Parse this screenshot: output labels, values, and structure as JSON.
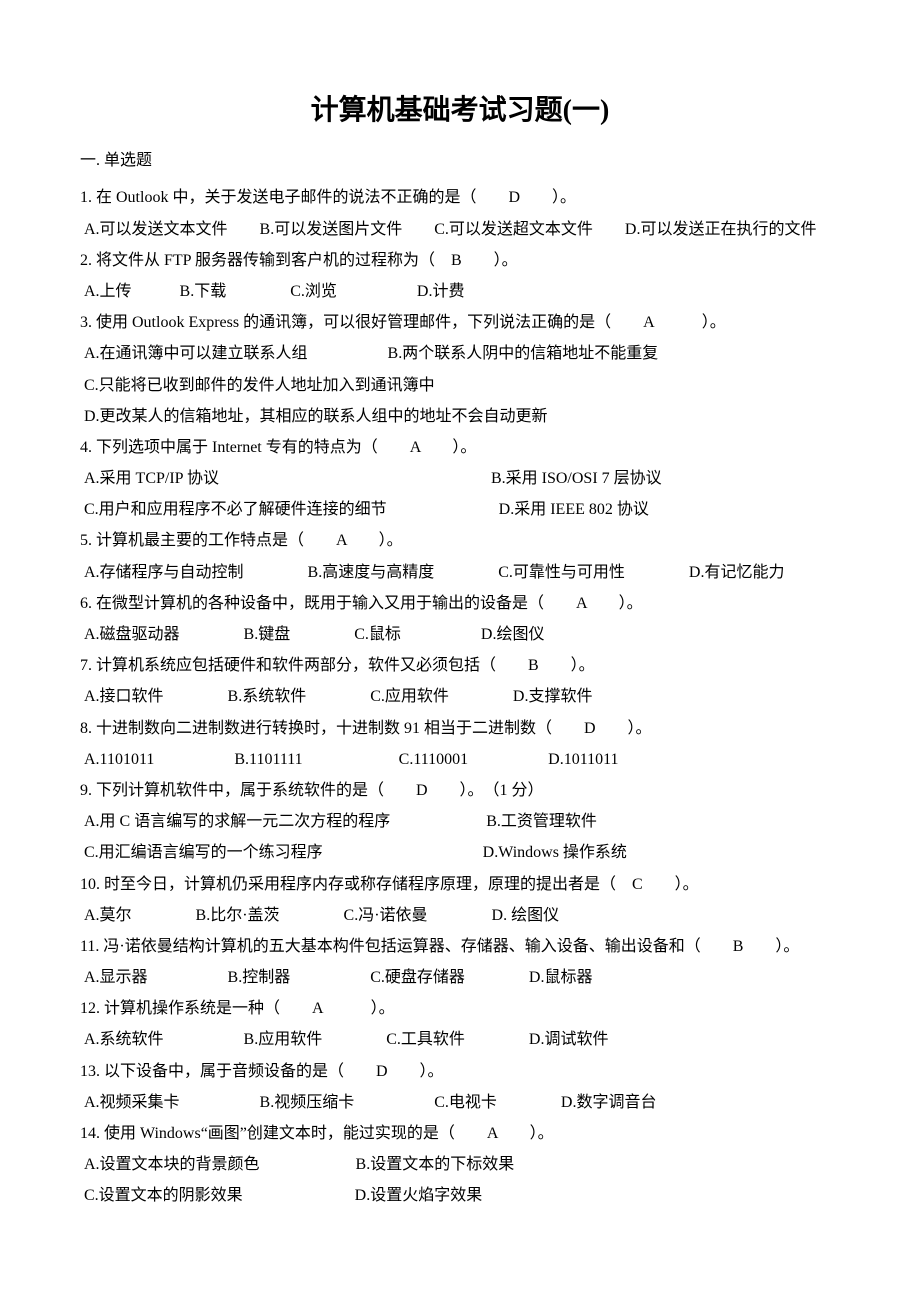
{
  "title": "计算机基础考试习题(一)",
  "section": "一. 单选题",
  "questions": [
    {
      "stem": "1. 在 Outlook 中，关于发送电子邮件的说法不正确的是（　　D　　）。",
      "opts": [
        "A.可以发送文本文件　　B.可以发送图片文件　　C.可以发送超文本文件　　D.可以发送正在执行的文件"
      ]
    },
    {
      "stem": "2. 将文件从 FTP 服务器传输到客户机的过程称为（　B　　）。",
      "opts": [
        "A.上传　　　B.下载　　　　C.浏览　　　　　D.计费"
      ]
    },
    {
      "stem": "3. 使用 Outlook Express 的通讯簿，可以很好管理邮件，下列说法正确的是（　　A　　　）。",
      "opts": [
        "A.在通讯簿中可以建立联系人组　　　　　B.两个联系人阴中的信箱地址不能重复",
        "C.只能将已收到邮件的发件人地址加入到通讯簿中",
        "D.更改某人的信箱地址，其相应的联系人组中的地址不会自动更新"
      ]
    },
    {
      "stem": "4. 下列选项中属于 Internet 专有的特点为（　　A　　）。",
      "opts": [
        "A.采用 TCP/IP 协议　　　　　　　　　　　　　　　　　B.采用 ISO/OSI 7 层协议",
        "C.用户和应用程序不必了解硬件连接的细节　　　　　　　D.采用 IEEE 802 协议"
      ]
    },
    {
      "stem": "5. 计算机最主要的工作特点是（　　A　　）。",
      "opts": [
        "A.存储程序与自动控制　　　　B.高速度与高精度　　　　C.可靠性与可用性　　　　D.有记忆能力"
      ]
    },
    {
      "stem": "6. 在微型计算机的各种设备中，既用于输入又用于输出的设备是（　　A　　）。",
      "opts": [
        "A.磁盘驱动器　　　　B.键盘　　　　C.鼠标　　　　　D.绘图仪"
      ]
    },
    {
      "stem": "7. 计算机系统应包括硬件和软件两部分，软件又必须包括（　　B　　）。",
      "opts": [
        "A.接口软件　　　　B.系统软件　　　　C.应用软件　　　　D.支撑软件"
      ]
    },
    {
      "stem": "8. 十进制数向二进制数进行转换时，十进制数 91 相当于二进制数（　　D　　）。",
      "opts": [
        "A.1101011　　　　　B.1101111　　　　　　C.1110001　　　　　D.1011011"
      ]
    },
    {
      "stem": "9. 下列计算机软件中，属于系统软件的是（　　D　　）。　（1 分）",
      "opts": [
        "A.用 C 语言编写的求解一元二次方程的程序　　　　　　B.工资管理软件",
        "C.用汇编语言编写的一个练习程序　　　　　　　　　　D.Windows 操作系统"
      ]
    },
    {
      "stem": "10. 时至今日，计算机仍采用程序内存或称存储程序原理，原理的提出者是（　C　　）。",
      "opts": [
        "A.莫尔　　　　B.比尔·盖茨　　　　C.冯·诺依曼　　　　D. 绘图仪"
      ]
    },
    {
      "stem": "11. 冯·诺依曼结构计算机的五大基本构件包括运算器、存储器、输入设备、输出设备和（　　B　　）。",
      "opts": [
        "A.显示器　　　　　B.控制器　　　　　C.硬盘存储器　　　　D.鼠标器"
      ]
    },
    {
      "stem": "12. 计算机操作系统是一种（　　A　　　）。",
      "opts": [
        "A.系统软件　　　　　B.应用软件　　　　C.工具软件　　　　D.调试软件"
      ]
    },
    {
      "stem": "13. 以下设备中，属于音频设备的是（　　D　　）。",
      "opts": [
        "A.视频采集卡　　　　　B.视频压缩卡　　　　　C.电视卡　　　　D.数字调音台"
      ]
    },
    {
      "stem": "14. 使用 Windows“画图”创建文本时，能过实现的是（　　A　　）。",
      "opts": [
        "A.设置文本块的背景颜色　　　　　　B.设置文本的下标效果",
        "C.设置文本的阴影效果　　　　　　　D.设置火焰字效果"
      ]
    }
  ]
}
